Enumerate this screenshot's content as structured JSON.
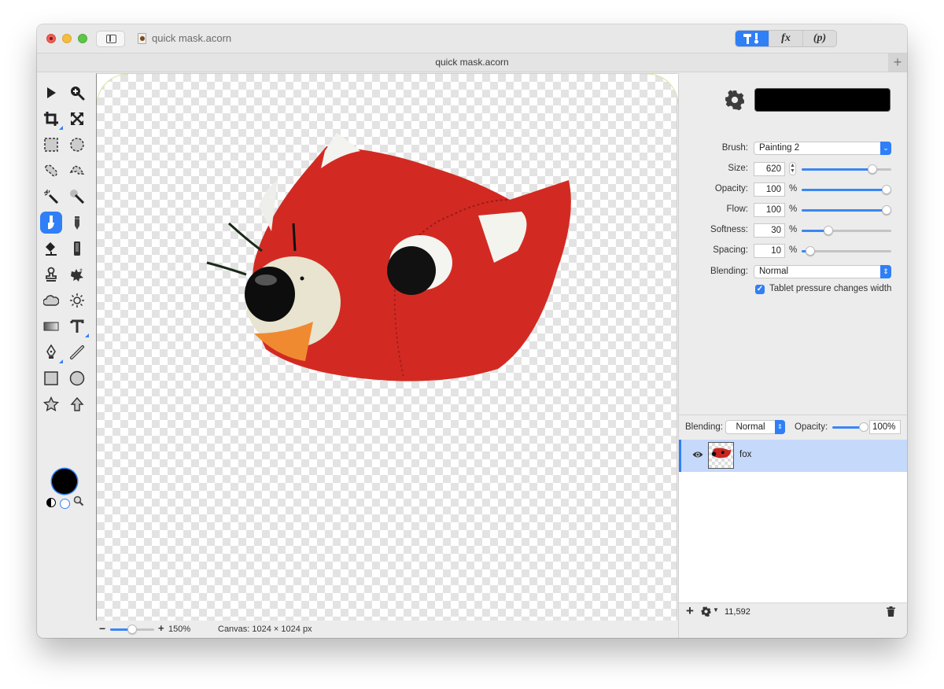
{
  "window": {
    "title": "quick mask.acorn",
    "tab_title": "quick mask.acorn",
    "new_tab_label": "+"
  },
  "toolbar": {
    "segments": [
      {
        "name": "tools",
        "label": "T!",
        "active": true
      },
      {
        "name": "filters",
        "label": "fx",
        "active": false
      },
      {
        "name": "properties",
        "label": "(p)",
        "active": false
      }
    ]
  },
  "tools": [
    {
      "name": "move-tool",
      "icon": "arrow-icon"
    },
    {
      "name": "zoom-tool",
      "icon": "zoom-in-icon"
    },
    {
      "name": "crop-tool",
      "icon": "crop-icon"
    },
    {
      "name": "transform-tool",
      "icon": "expand-icon"
    },
    {
      "name": "rect-select-tool",
      "icon": "rect-marquee-icon"
    },
    {
      "name": "ellipse-select-tool",
      "icon": "ellipse-marquee-icon"
    },
    {
      "name": "lasso-tool",
      "icon": "lasso-icon"
    },
    {
      "name": "polygon-lasso-tool",
      "icon": "polygon-lasso-icon"
    },
    {
      "name": "magic-wand-tool",
      "icon": "magic-wand-icon"
    },
    {
      "name": "instant-alpha-tool",
      "icon": "instant-alpha-icon"
    },
    {
      "name": "brush-tool",
      "icon": "brush-icon",
      "active": true
    },
    {
      "name": "pencil-tool",
      "icon": "pencil-icon"
    },
    {
      "name": "paint-bucket-tool",
      "icon": "paint-bucket-icon"
    },
    {
      "name": "eraser-tool",
      "icon": "eraser-icon"
    },
    {
      "name": "clone-tool",
      "icon": "stamp-icon"
    },
    {
      "name": "smudge-tool",
      "icon": "splatter-icon"
    },
    {
      "name": "burn-tool",
      "icon": "cloud-icon"
    },
    {
      "name": "dodge-tool",
      "icon": "sun-icon"
    },
    {
      "name": "gradient-tool",
      "icon": "gradient-icon"
    },
    {
      "name": "text-tool",
      "icon": "text-icon"
    },
    {
      "name": "pen-tool",
      "icon": "pen-nib-icon"
    },
    {
      "name": "line-tool",
      "icon": "line-icon"
    },
    {
      "name": "rectangle-tool",
      "icon": "square-icon"
    },
    {
      "name": "oval-tool",
      "icon": "circle-icon"
    },
    {
      "name": "star-tool",
      "icon": "star-icon"
    },
    {
      "name": "arrow-shape-tool",
      "icon": "up-arrow-icon"
    }
  ],
  "colors": {
    "foreground": "#000000",
    "accent": "#2f7ff7",
    "selected_layer_bg": "#c5d9fb"
  },
  "status": {
    "zoom_minus": "−",
    "zoom_plus": "+",
    "zoom_value": "150%",
    "zoom_fraction": 0.5,
    "canvas_size": "Canvas: 1024 × 1024 px"
  },
  "brush_settings": {
    "brush_label": "Brush:",
    "brush_value": "Painting 2",
    "size_label": "Size:",
    "size_value": "620",
    "size_fraction": 0.79,
    "opacity_label": "Opacity:",
    "opacity_value": "100",
    "opacity_fraction": 1.0,
    "flow_label": "Flow:",
    "flow_value": "100",
    "flow_fraction": 1.0,
    "softness_label": "Softness:",
    "softness_value": "30",
    "softness_fraction": 0.3,
    "spacing_label": "Spacing:",
    "spacing_value": "10",
    "spacing_fraction": 0.1,
    "percent_unit": "%",
    "blending_label": "Blending:",
    "blending_value": "Normal",
    "tablet_pressure_label": "Tablet pressure changes width",
    "tablet_pressure_checked": true
  },
  "layers": {
    "blending_label": "Blending:",
    "blending_value": "Normal",
    "opacity_label": "Opacity:",
    "opacity_value": "100%",
    "items": [
      {
        "name": "fox",
        "visible": true,
        "selected": true
      }
    ],
    "footer_count": "11,592"
  }
}
